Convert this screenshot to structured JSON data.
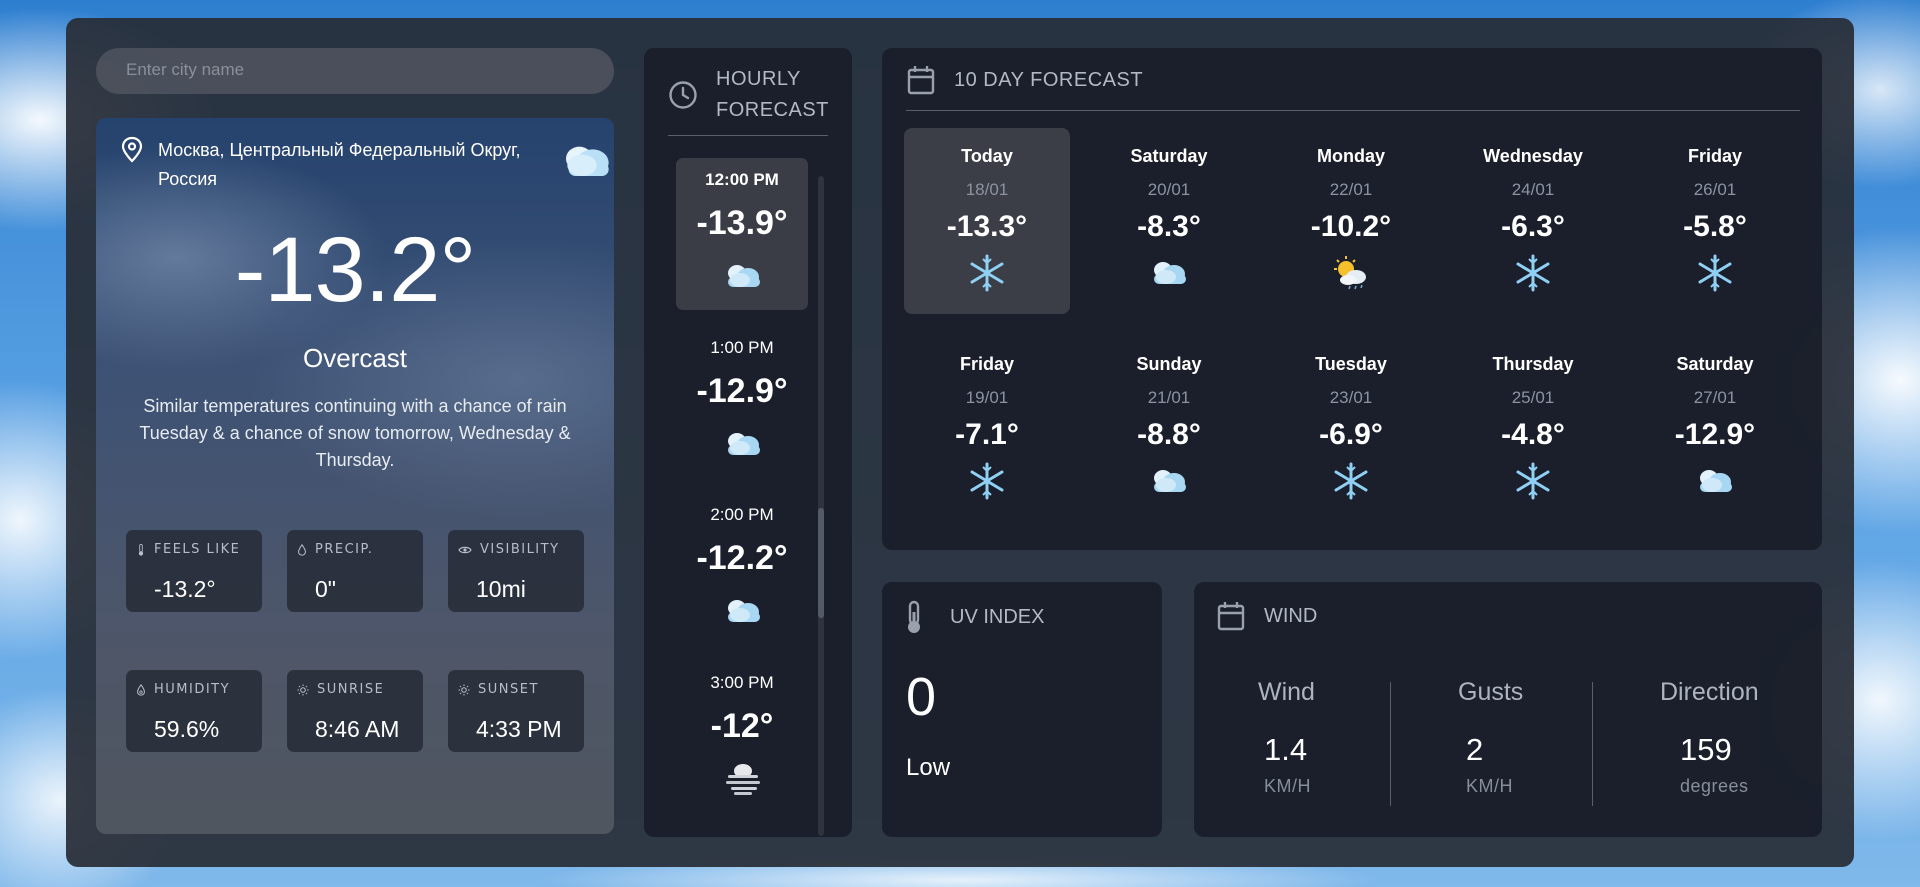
{
  "search": {
    "placeholder": "Enter city name"
  },
  "current": {
    "location": "Москва, Центральный Федеральный Округ, Россия",
    "icon": "cloud-sun-icon",
    "temperature": "-13.2°",
    "condition": "Overcast",
    "description": "Similar temperatures continuing with a chance of rain Tuesday & a chance of snow tomorrow, Wednesday & Thursday.",
    "stats": [
      {
        "label": "FEELS LIKE",
        "value": "-13.2°",
        "icon": "thermometer-icon"
      },
      {
        "label": "PRECIP.",
        "value": "0\"",
        "icon": "droplet-icon"
      },
      {
        "label": "VISIBILITY",
        "value": "10mi",
        "icon": "eye-icon"
      },
      {
        "label": "HUMIDITY",
        "value": "59.6%",
        "icon": "humidity-icon"
      },
      {
        "label": "SUNRISE",
        "value": "8:46 AM",
        "icon": "sun-icon"
      },
      {
        "label": "SUNSET",
        "value": "4:33 PM",
        "icon": "sun-icon"
      }
    ]
  },
  "hourly": {
    "title": "HOURLY FORECAST",
    "items": [
      {
        "time": "12:00 PM",
        "temp": "-13.9°",
        "icon": "cloud-icon"
      },
      {
        "time": "1:00 PM",
        "temp": "-12.9°",
        "icon": "cloud-icon"
      },
      {
        "time": "2:00 PM",
        "temp": "-12.2°",
        "icon": "cloud-icon"
      },
      {
        "time": "3:00 PM",
        "temp": "-12°",
        "icon": "fog-icon"
      }
    ]
  },
  "ten_day": {
    "title": "10 DAY FORECAST",
    "days": [
      {
        "name": "Today",
        "date": "18/01",
        "temp": "-13.3°",
        "icon": "snowflake-icon"
      },
      {
        "name": "Saturday",
        "date": "20/01",
        "temp": "-8.3°",
        "icon": "cloud-icon"
      },
      {
        "name": "Monday",
        "date": "22/01",
        "temp": "-10.2°",
        "icon": "partly-sunny-icon"
      },
      {
        "name": "Wednesday",
        "date": "24/01",
        "temp": "-6.3°",
        "icon": "snowflake-icon"
      },
      {
        "name": "Friday",
        "date": "26/01",
        "temp": "-5.8°",
        "icon": "snowflake-icon"
      },
      {
        "name": "Friday",
        "date": "19/01",
        "temp": "-7.1°",
        "icon": "snowflake-icon"
      },
      {
        "name": "Sunday",
        "date": "21/01",
        "temp": "-8.8°",
        "icon": "cloud-icon"
      },
      {
        "name": "Tuesday",
        "date": "23/01",
        "temp": "-6.9°",
        "icon": "snowflake-icon"
      },
      {
        "name": "Thursday",
        "date": "25/01",
        "temp": "-4.8°",
        "icon": "snowflake-icon"
      },
      {
        "name": "Saturday",
        "date": "27/01",
        "temp": "-12.9°",
        "icon": "cloud-icon"
      }
    ]
  },
  "uv": {
    "title": "UV INDEX",
    "value": "0",
    "level": "Low"
  },
  "wind": {
    "title": "WIND",
    "columns": [
      {
        "heading": "Wind",
        "value": "1.4",
        "unit": "KM/H"
      },
      {
        "heading": "Gusts",
        "value": "2",
        "unit": "KM/H"
      },
      {
        "heading": "Direction",
        "value": "159",
        "unit": "degrees"
      }
    ]
  }
}
